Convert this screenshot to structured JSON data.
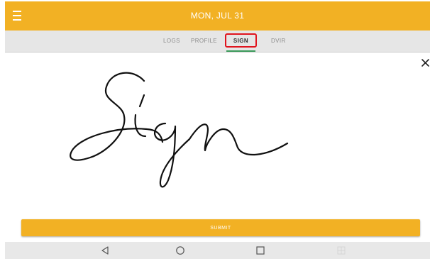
{
  "header": {
    "title": "MON, JUL 31",
    "menu_icon": "hamburger-menu-icon",
    "background": "#f2b124"
  },
  "tabs": [
    {
      "label": "LOGS",
      "active": false
    },
    {
      "label": "PROFILE",
      "active": false
    },
    {
      "label": "SIGN",
      "active": true
    },
    {
      "label": "DVIR",
      "active": false
    }
  ],
  "signature": {
    "close_icon": "close-icon"
  },
  "footer": {
    "submit_label": "SUBMIT"
  },
  "system_nav": {
    "back_icon": "back-triangle-icon",
    "home_icon": "home-circle-icon",
    "recents_icon": "recents-square-icon",
    "grid_icon": "grid-icon"
  },
  "colors": {
    "accent": "#f2b124",
    "highlight": "#e0141e",
    "tab_indicator": "#3a9a5a"
  }
}
